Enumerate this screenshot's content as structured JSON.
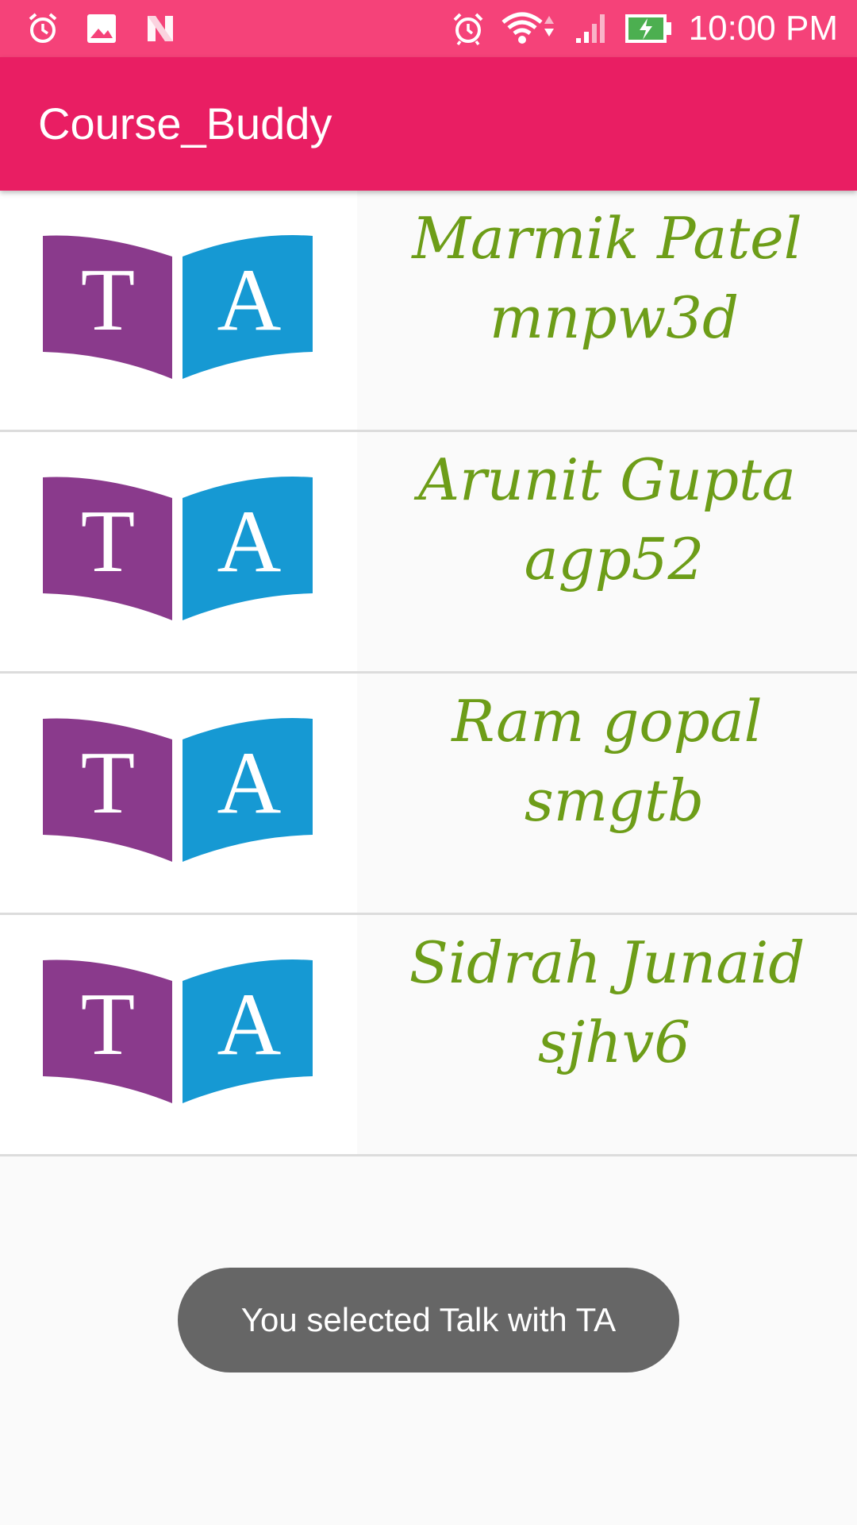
{
  "status_bar": {
    "time": "10:00 PM",
    "left_icons": [
      "alarm-clock-icon",
      "image-icon",
      "n-logo-icon"
    ],
    "right_icons": [
      "alarm-icon",
      "wifi-icon",
      "signal-icon",
      "battery-charging-icon"
    ]
  },
  "app_bar": {
    "title": "Course_Buddy"
  },
  "ta_list": {
    "items": [
      {
        "name": "Marmik Patel",
        "id": "mnpw3d",
        "logo_letters": [
          "T",
          "A"
        ]
      },
      {
        "name": "Arunit Gupta",
        "id": "agp52",
        "logo_letters": [
          "T",
          "A"
        ]
      },
      {
        "name": "Ram gopal",
        "id": "smgtb",
        "logo_letters": [
          "T",
          "A"
        ]
      },
      {
        "name": "Sidrah Junaid",
        "id": "sjhv6",
        "logo_letters": [
          "T",
          "A"
        ]
      }
    ]
  },
  "toast": {
    "message": "You selected Talk with TA"
  },
  "colors": {
    "status_bar": "#f54279",
    "app_bar": "#e91e63",
    "name_text": "#6d9d18",
    "logo_purple": "#8a3a8c",
    "logo_blue": "#1699d3",
    "toast_bg": "#666666"
  }
}
